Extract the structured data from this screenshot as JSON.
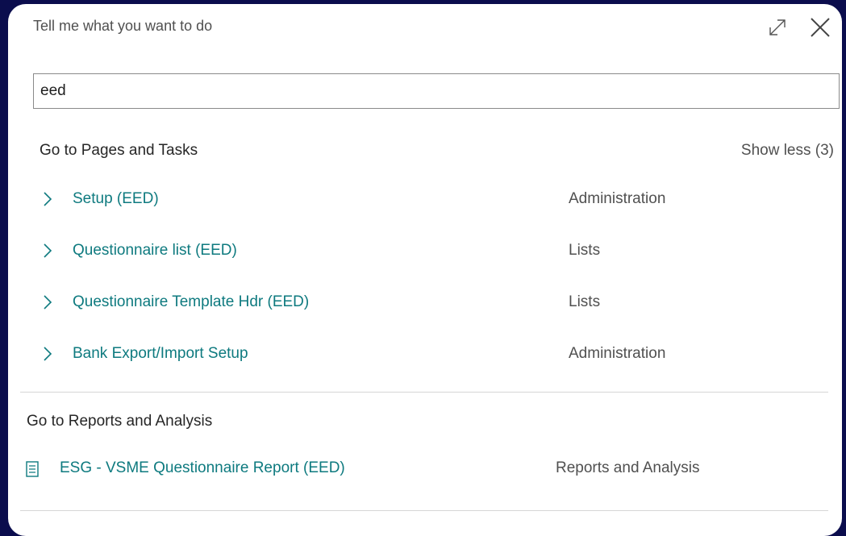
{
  "dialog": {
    "title": "Tell me what you want to do",
    "icons": {
      "expand": "expand-icon",
      "close": "close-icon"
    }
  },
  "search": {
    "value": "eed",
    "placeholder": ""
  },
  "pages_section": {
    "title": "Go to Pages and Tasks",
    "toggle_label": "Show less (3)",
    "items": [
      {
        "label": "Setup (EED)",
        "category": "Administration"
      },
      {
        "label": "Questionnaire list (EED)",
        "category": "Lists"
      },
      {
        "label": "Questionnaire Template Hdr (EED)",
        "category": "Lists"
      },
      {
        "label": "Bank Export/Import Setup",
        "category": "Administration"
      }
    ]
  },
  "reports_section": {
    "title": "Go to Reports and Analysis",
    "items": [
      {
        "label": "ESG - VSME Questionnaire Report (EED)",
        "category": "Reports and Analysis",
        "icon": "report-document-icon"
      }
    ]
  },
  "colors": {
    "link": "#0e7a7f",
    "background": "#0b0d4d",
    "panel": "#ffffff"
  }
}
